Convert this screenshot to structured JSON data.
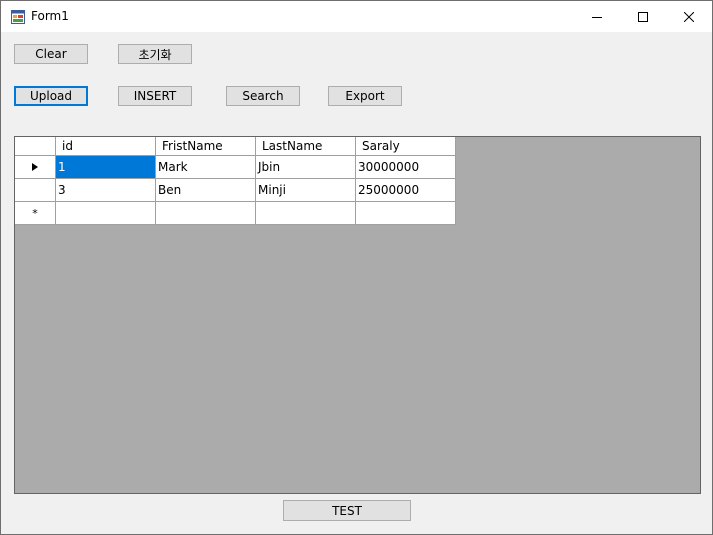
{
  "window": {
    "title": "Form1",
    "controls": {
      "minimize": "minimize-icon",
      "maximize": "maximize-icon",
      "close": "close-icon"
    }
  },
  "toolbar": {
    "clear_label": "Clear",
    "reset_label": "초기화",
    "upload_label": "Upload",
    "insert_label": "INSERT",
    "search_label": "Search",
    "export_label": "Export"
  },
  "grid": {
    "columns": [
      "id",
      "FristName",
      "LastName",
      "Saraly"
    ],
    "rows": [
      {
        "id": "1",
        "first": "Mark",
        "last": "Jbin",
        "salary": "30000000",
        "current": true
      },
      {
        "id": "3",
        "first": "Ben",
        "last": "Minji",
        "salary": "25000000",
        "current": false
      }
    ],
    "new_row_marker": "*",
    "current_row_icon": "row-pointer-icon",
    "colors": {
      "selection": "#0078d7",
      "background": "#ababab"
    }
  },
  "footer": {
    "test_label": "TEST"
  }
}
